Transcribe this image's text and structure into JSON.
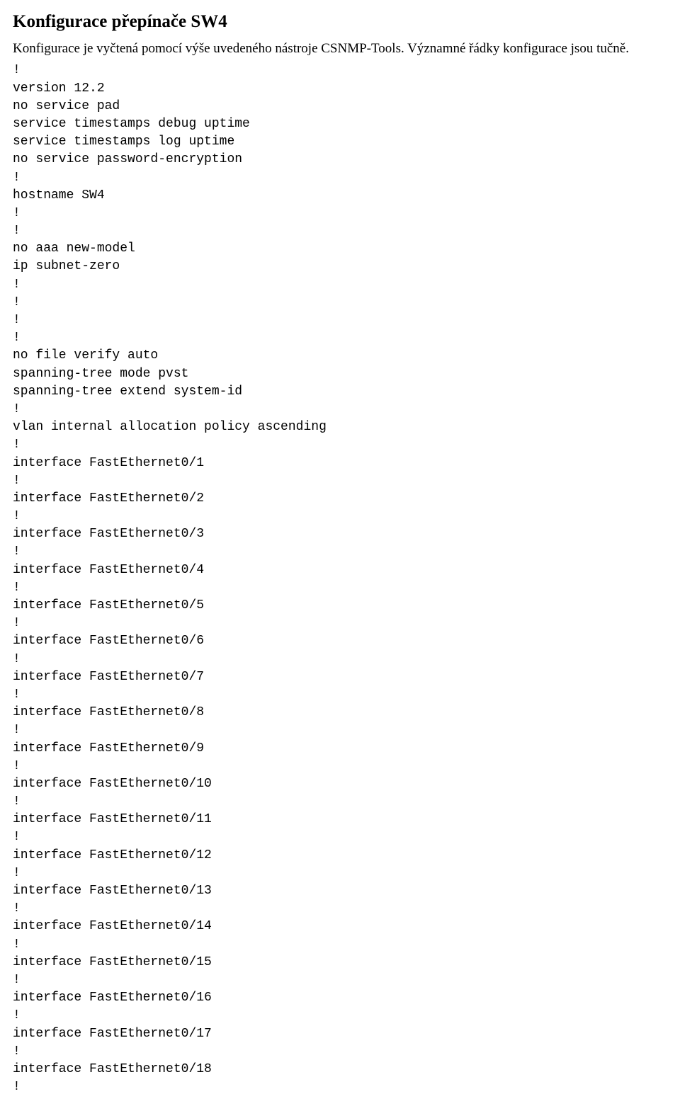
{
  "heading": "Konfigurace přepínače SW4",
  "intro": "Konfigurace je vyčtená pomocí výše uvedeného nástroje CSNMP-Tools. Významné řádky konfigurace jsou tučně.",
  "config": "!\nversion 12.2\nno service pad\nservice timestamps debug uptime\nservice timestamps log uptime\nno service password-encryption\n!\nhostname SW4\n!\n!\nno aaa new-model\nip subnet-zero\n!\n!\n!\n!\nno file verify auto\nspanning-tree mode pvst\nspanning-tree extend system-id\n!\nvlan internal allocation policy ascending\n!\ninterface FastEthernet0/1\n!\ninterface FastEthernet0/2\n!\ninterface FastEthernet0/3\n!\ninterface FastEthernet0/4\n!\ninterface FastEthernet0/5\n!\ninterface FastEthernet0/6\n!\ninterface FastEthernet0/7\n!\ninterface FastEthernet0/8\n!\ninterface FastEthernet0/9\n!\ninterface FastEthernet0/10\n!\ninterface FastEthernet0/11\n!\ninterface FastEthernet0/12\n!\ninterface FastEthernet0/13\n!\ninterface FastEthernet0/14\n!\ninterface FastEthernet0/15\n!\ninterface FastEthernet0/16\n!\ninterface FastEthernet0/17\n!\ninterface FastEthernet0/18\n!"
}
